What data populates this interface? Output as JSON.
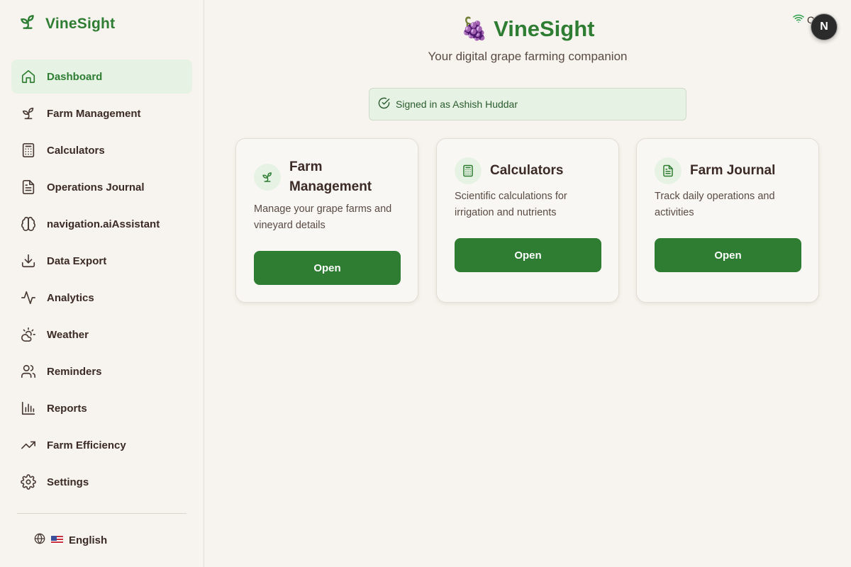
{
  "brand": {
    "name": "VineSight",
    "icon": "sprout-icon"
  },
  "sidebar": {
    "items": [
      {
        "label": "Dashboard",
        "icon": "home-icon",
        "active": true
      },
      {
        "label": "Farm Management",
        "icon": "sprout-icon"
      },
      {
        "label": "Calculators",
        "icon": "calculator-icon"
      },
      {
        "label": "Operations Journal",
        "icon": "file-text-icon"
      },
      {
        "label": "navigation.aiAssistant",
        "icon": "brain-icon"
      },
      {
        "label": "Data Export",
        "icon": "download-icon"
      },
      {
        "label": "Analytics",
        "icon": "activity-icon"
      },
      {
        "label": "Weather",
        "icon": "cloud-sun-icon"
      },
      {
        "label": "Reminders",
        "icon": "users-icon"
      },
      {
        "label": "Reports",
        "icon": "bar-chart-icon"
      },
      {
        "label": "Farm Efficiency",
        "icon": "trending-up-icon"
      },
      {
        "label": "Settings",
        "icon": "gear-icon"
      }
    ],
    "language": "English"
  },
  "header": {
    "emoji": "🍇",
    "title": "VineSight",
    "subtitle": "Your digital grape farming companion",
    "status": "Online",
    "avatar_letter": "N"
  },
  "signed_in": "Signed in as Ashish Huddar",
  "cards": [
    {
      "title": "Farm Management",
      "description": "Manage your grape farms and vineyard details",
      "button": "Open",
      "icon": "sprout-icon"
    },
    {
      "title": "Calculators",
      "description": "Scientific calculations for irrigation and nutrients",
      "button": "Open",
      "icon": "calculator-icon"
    },
    {
      "title": "Farm Journal",
      "description": "Track daily operations and activities",
      "button": "Open",
      "icon": "file-text-icon"
    }
  ],
  "colors": {
    "accent": "#2e7d32",
    "background": "#f7f4ef",
    "active_bg": "#e6f3e4",
    "text": "#3b2a25"
  }
}
